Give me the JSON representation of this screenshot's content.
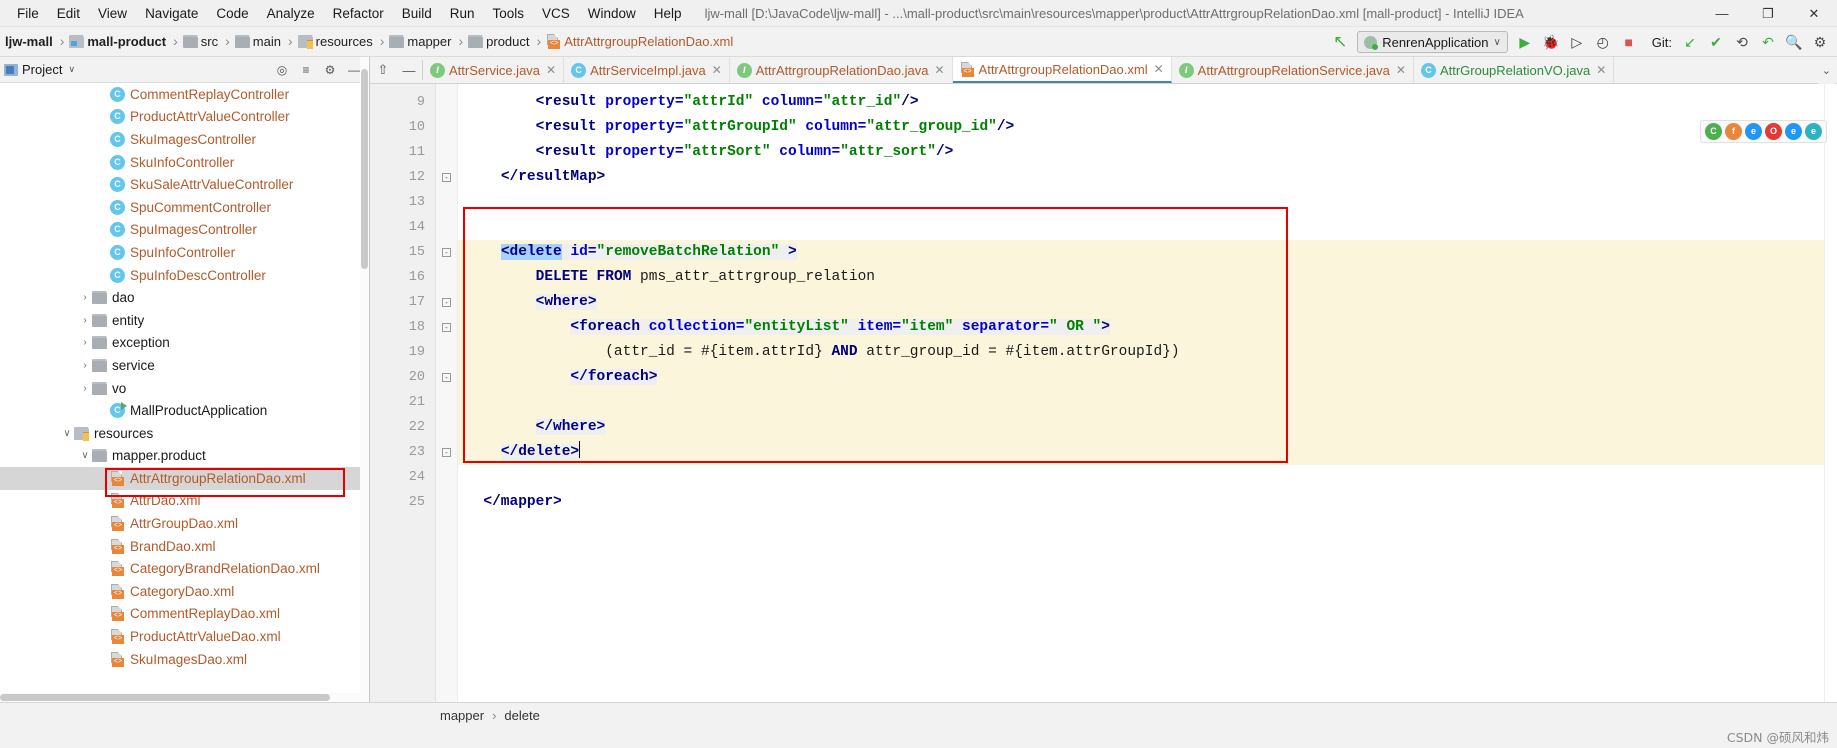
{
  "window": {
    "title": "ljw-mall [D:\\JavaCode\\ljw-mall] - ...\\mall-product\\src\\main\\resources\\mapper\\product\\AttrAttrgroupRelationDao.xml [mall-product] - IntelliJ IDEA",
    "minimize": "—",
    "maximize": "❐",
    "close": "✕"
  },
  "menu": {
    "items": [
      {
        "label": "File"
      },
      {
        "label": "Edit"
      },
      {
        "label": "View"
      },
      {
        "label": "Navigate"
      },
      {
        "label": "Code"
      },
      {
        "label": "Analyze"
      },
      {
        "label": "Refactor"
      },
      {
        "label": "Build"
      },
      {
        "label": "Run"
      },
      {
        "label": "Tools"
      },
      {
        "label": "VCS"
      },
      {
        "label": "Window"
      },
      {
        "label": "Help"
      }
    ]
  },
  "breadcrumb": {
    "items": [
      {
        "label": "ljw-mall",
        "icon": "project-icon"
      },
      {
        "label": "mall-product",
        "icon": "module-folder-icon"
      },
      {
        "label": "src",
        "icon": "folder-icon"
      },
      {
        "label": "main",
        "icon": "folder-icon"
      },
      {
        "label": "resources",
        "icon": "resources-folder-icon"
      },
      {
        "label": "mapper",
        "icon": "folder-icon"
      },
      {
        "label": "product",
        "icon": "folder-icon"
      },
      {
        "label": "AttrAttrgroupRelationDao.xml",
        "icon": "xml-file-icon"
      }
    ],
    "separator": "›"
  },
  "toolbar": {
    "back_arrow": "↖",
    "run_config": "RenrenApplication",
    "run_config_caret": "∨",
    "run_button": "▶",
    "debug_button": "🐞",
    "run_coverage_button": "▷",
    "profile_button": "◴",
    "stop_button": "■",
    "git_label": "Git:",
    "git_update": "↙",
    "git_commit": "✔",
    "git_history": "⟲",
    "git_rollback": "↶",
    "search_everywhere": "🔍",
    "settings": "⚙"
  },
  "project_panel": {
    "title": "Project",
    "caret": "∨",
    "icons": [
      "collapse-icon",
      "expand-icon",
      "settings-icon",
      "hide-icon"
    ],
    "tree": [
      {
        "indent": 5,
        "arrow": "",
        "icon": "class-icon",
        "icon_char": "C",
        "label": "CommentReplayController",
        "style": "java-orange",
        "selected": false
      },
      {
        "indent": 5,
        "arrow": "",
        "icon": "class-icon",
        "icon_char": "C",
        "label": "ProductAttrValueController",
        "style": "java-orange",
        "selected": false
      },
      {
        "indent": 5,
        "arrow": "",
        "icon": "class-icon",
        "icon_char": "C",
        "label": "SkuImagesController",
        "style": "java-orange",
        "selected": false
      },
      {
        "indent": 5,
        "arrow": "",
        "icon": "class-icon",
        "icon_char": "C",
        "label": "SkuInfoController",
        "style": "java-orange",
        "selected": false
      },
      {
        "indent": 5,
        "arrow": "",
        "icon": "class-icon",
        "icon_char": "C",
        "label": "SkuSaleAttrValueController",
        "style": "java-orange",
        "selected": false
      },
      {
        "indent": 5,
        "arrow": "",
        "icon": "class-icon",
        "icon_char": "C",
        "label": "SpuCommentController",
        "style": "java-orange",
        "selected": false
      },
      {
        "indent": 5,
        "arrow": "",
        "icon": "class-icon",
        "icon_char": "C",
        "label": "SpuImagesController",
        "style": "java-orange",
        "selected": false
      },
      {
        "indent": 5,
        "arrow": "",
        "icon": "class-icon",
        "icon_char": "C",
        "label": "SpuInfoController",
        "style": "java-orange",
        "selected": false
      },
      {
        "indent": 5,
        "arrow": "",
        "icon": "class-icon",
        "icon_char": "C",
        "label": "SpuInfoDescController",
        "style": "java-orange",
        "selected": false
      },
      {
        "indent": 4,
        "arrow": "›",
        "icon": "folder-icon",
        "icon_char": "",
        "label": "dao",
        "style": "plain",
        "selected": false
      },
      {
        "indent": 4,
        "arrow": "›",
        "icon": "folder-icon",
        "icon_char": "",
        "label": "entity",
        "style": "plain",
        "selected": false
      },
      {
        "indent": 4,
        "arrow": "›",
        "icon": "folder-icon",
        "icon_char": "",
        "label": "exception",
        "style": "plain",
        "selected": false
      },
      {
        "indent": 4,
        "arrow": "›",
        "icon": "folder-icon",
        "icon_char": "",
        "label": "service",
        "style": "plain",
        "selected": false
      },
      {
        "indent": 4,
        "arrow": "›",
        "icon": "folder-icon",
        "icon_char": "",
        "label": "vo",
        "style": "plain",
        "selected": false
      },
      {
        "indent": 5,
        "arrow": "",
        "icon": "spring-boot-class-icon",
        "icon_char": "C",
        "label": "MallProductApplication",
        "style": "plain",
        "selected": false
      },
      {
        "indent": 3,
        "arrow": "∨",
        "icon": "resources-folder-icon",
        "icon_char": "",
        "label": "resources",
        "style": "plain",
        "selected": false
      },
      {
        "indent": 4,
        "arrow": "∨",
        "icon": "folder-icon",
        "icon_char": "",
        "label": "mapper.product",
        "style": "plain",
        "selected": false
      },
      {
        "indent": 5,
        "arrow": "",
        "icon": "xml-file-icon",
        "icon_char": "",
        "label": "AttrAttrgroupRelationDao.xml",
        "style": "xml-orange",
        "selected": true
      },
      {
        "indent": 5,
        "arrow": "",
        "icon": "xml-file-icon",
        "icon_char": "",
        "label": "AttrDao.xml",
        "style": "xml-orange",
        "selected": false
      },
      {
        "indent": 5,
        "arrow": "",
        "icon": "xml-file-icon",
        "icon_char": "",
        "label": "AttrGroupDao.xml",
        "style": "xml-orange",
        "selected": false
      },
      {
        "indent": 5,
        "arrow": "",
        "icon": "xml-file-icon",
        "icon_char": "",
        "label": "BrandDao.xml",
        "style": "xml-orange",
        "selected": false
      },
      {
        "indent": 5,
        "arrow": "",
        "icon": "xml-file-icon",
        "icon_char": "",
        "label": "CategoryBrandRelationDao.xml",
        "style": "xml-orange",
        "selected": false
      },
      {
        "indent": 5,
        "arrow": "",
        "icon": "xml-file-icon",
        "icon_char": "",
        "label": "CategoryDao.xml",
        "style": "xml-orange",
        "selected": false
      },
      {
        "indent": 5,
        "arrow": "",
        "icon": "xml-file-icon",
        "icon_char": "",
        "label": "CommentReplayDao.xml",
        "style": "xml-orange",
        "selected": false
      },
      {
        "indent": 5,
        "arrow": "",
        "icon": "xml-file-icon",
        "icon_char": "",
        "label": "ProductAttrValueDao.xml",
        "style": "xml-orange",
        "selected": false
      },
      {
        "indent": 5,
        "arrow": "",
        "icon": "xml-file-icon",
        "icon_char": "",
        "label": "SkuImagesDao.xml",
        "style": "xml-orange",
        "selected": false
      }
    ]
  },
  "editor_tabs": {
    "pin_icon": "⇧",
    "minimize_icon": "—",
    "items": [
      {
        "label": "AttrService.java",
        "icon": "interface-icon",
        "icon_char": "I",
        "kind": "iface",
        "active": false,
        "close": "✕"
      },
      {
        "label": "AttrServiceImpl.java",
        "icon": "class-icon",
        "icon_char": "C",
        "kind": "class",
        "active": false,
        "close": "✕"
      },
      {
        "label": "AttrAttrgroupRelationDao.java",
        "icon": "interface-icon",
        "icon_char": "I",
        "kind": "iface",
        "active": false,
        "close": "✕"
      },
      {
        "label": "AttrAttrgroupRelationDao.xml",
        "icon": "xml-file-icon",
        "icon_char": "",
        "kind": "xml",
        "active": true,
        "close": "✕"
      },
      {
        "label": "AttrAttrgroupRelationService.java",
        "icon": "interface-icon",
        "icon_char": "I",
        "kind": "iface",
        "active": false,
        "close": "✕"
      },
      {
        "label": "AttrGroupRelationVO.java",
        "icon": "class-icon",
        "icon_char": "C",
        "kind": "class-green",
        "active": false,
        "close": "✕"
      }
    ],
    "overflow": "⌄"
  },
  "browsers": [
    {
      "name": "chrome-icon",
      "char": "C",
      "color": "#4caf50"
    },
    {
      "name": "firefox-icon",
      "char": "f",
      "color": "#e8863c"
    },
    {
      "name": "edge-chromium-icon",
      "char": "e",
      "color": "#2196f3"
    },
    {
      "name": "opera-icon",
      "char": "O",
      "color": "#e53935"
    },
    {
      "name": "internet-explorer-icon",
      "char": "e",
      "color": "#2196f3"
    },
    {
      "name": "edge-icon",
      "char": "e",
      "color": "#2bb3c0"
    }
  ],
  "code": {
    "lines": [
      {
        "num": "9",
        "fold": "",
        "highlight": false,
        "indent": 1,
        "tokens": [
          {
            "t": "        ",
            "c": "plain"
          },
          {
            "t": "<result ",
            "c": "tag"
          },
          {
            "t": "property=",
            "c": "attr"
          },
          {
            "t": "\"attrId\"",
            "c": "val"
          },
          {
            "t": " ",
            "c": "plain"
          },
          {
            "t": "column=",
            "c": "attr"
          },
          {
            "t": "\"attr_id\"",
            "c": "val"
          },
          {
            "t": "/>",
            "c": "tag"
          }
        ]
      },
      {
        "num": "10",
        "fold": "",
        "highlight": false,
        "indent": 1,
        "tokens": [
          {
            "t": "        ",
            "c": "plain"
          },
          {
            "t": "<result ",
            "c": "tag"
          },
          {
            "t": "property=",
            "c": "attr"
          },
          {
            "t": "\"attrGroupId\"",
            "c": "val"
          },
          {
            "t": " ",
            "c": "plain"
          },
          {
            "t": "column=",
            "c": "attr"
          },
          {
            "t": "\"attr_group_id\"",
            "c": "val"
          },
          {
            "t": "/>",
            "c": "tag"
          }
        ]
      },
      {
        "num": "11",
        "fold": "",
        "highlight": false,
        "indent": 1,
        "tokens": [
          {
            "t": "        ",
            "c": "plain"
          },
          {
            "t": "<result ",
            "c": "tag"
          },
          {
            "t": "property=",
            "c": "attr"
          },
          {
            "t": "\"attrSort\"",
            "c": "val"
          },
          {
            "t": " ",
            "c": "plain"
          },
          {
            "t": "column=",
            "c": "attr"
          },
          {
            "t": "\"attr_sort\"",
            "c": "val"
          },
          {
            "t": "/>",
            "c": "tag"
          }
        ]
      },
      {
        "num": "12",
        "fold": "-",
        "highlight": false,
        "indent": 0,
        "tokens": [
          {
            "t": "    ",
            "c": "plain"
          },
          {
            "t": "</resultMap>",
            "c": "tag"
          }
        ]
      },
      {
        "num": "13",
        "fold": "",
        "highlight": false,
        "indent": 0,
        "tokens": []
      },
      {
        "num": "14",
        "fold": "",
        "highlight": false,
        "indent": 0,
        "tokens": []
      },
      {
        "num": "15",
        "fold": "-",
        "highlight": true,
        "indent": 0,
        "tokens": [
          {
            "t": "    ",
            "c": "plain"
          },
          {
            "t": "<delete",
            "c": "tag-sel"
          },
          {
            "t": " ",
            "c": "plain-bg"
          },
          {
            "t": "id=",
            "c": "attr-bg"
          },
          {
            "t": "\"removeBatchRelation\"",
            "c": "val-bg"
          },
          {
            "t": " >",
            "c": "tag-bg"
          }
        ]
      },
      {
        "num": "16",
        "fold": "",
        "highlight": true,
        "indent": 1,
        "tokens": [
          {
            "t": "        ",
            "c": "plain"
          },
          {
            "t": "DELETE FROM",
            "c": "sql"
          },
          {
            "t": " pms_attr_attrgroup_relation",
            "c": "plain"
          }
        ]
      },
      {
        "num": "17",
        "fold": "-",
        "highlight": true,
        "indent": 1,
        "tokens": [
          {
            "t": "        ",
            "c": "plain"
          },
          {
            "t": "<where>",
            "c": "tag-bg"
          }
        ]
      },
      {
        "num": "18",
        "fold": "-",
        "highlight": true,
        "indent": 2,
        "tokens": [
          {
            "t": "            ",
            "c": "plain"
          },
          {
            "t": "<foreach ",
            "c": "tag-bg"
          },
          {
            "t": "collection=",
            "c": "attr-bg"
          },
          {
            "t": "\"entityList\"",
            "c": "val-bg"
          },
          {
            "t": " ",
            "c": "plain-bg"
          },
          {
            "t": "item=",
            "c": "attr-bg"
          },
          {
            "t": "\"item\"",
            "c": "val-bg"
          },
          {
            "t": " ",
            "c": "plain-bg"
          },
          {
            "t": "separator=",
            "c": "attr-bg"
          },
          {
            "t": "\" OR \"",
            "c": "val-bg"
          },
          {
            "t": ">",
            "c": "tag-bg"
          }
        ]
      },
      {
        "num": "19",
        "fold": "",
        "highlight": true,
        "indent": 3,
        "tokens": [
          {
            "t": "                ",
            "c": "plain"
          },
          {
            "t": "(attr_id = #{item.attrId} ",
            "c": "plain"
          },
          {
            "t": "AND",
            "c": "sql"
          },
          {
            "t": " attr_group_id = #{item.attrGroupId})",
            "c": "plain"
          }
        ]
      },
      {
        "num": "20",
        "fold": "-",
        "highlight": true,
        "indent": 2,
        "tokens": [
          {
            "t": "            ",
            "c": "plain"
          },
          {
            "t": "</foreach>",
            "c": "tag-bg"
          }
        ]
      },
      {
        "num": "21",
        "fold": "",
        "highlight": true,
        "indent": 2,
        "tokens": []
      },
      {
        "num": "22",
        "fold": "",
        "highlight": true,
        "indent": 1,
        "tokens": [
          {
            "t": "        ",
            "c": "plain"
          },
          {
            "t": "</where>",
            "c": "tag-bg"
          }
        ]
      },
      {
        "num": "23",
        "fold": "-",
        "highlight": true,
        "indent": 0,
        "tokens": [
          {
            "t": "    ",
            "c": "plain"
          },
          {
            "t": "</delete>",
            "c": "tag-bg"
          },
          {
            "t": "|",
            "c": "caret"
          }
        ]
      },
      {
        "num": "24",
        "fold": "",
        "highlight": false,
        "indent": 0,
        "tokens": []
      },
      {
        "num": "25",
        "fold": "",
        "highlight": false,
        "indent": 0,
        "tokens": [
          {
            "t": "  ",
            "c": "plain"
          },
          {
            "t": "</mapper>",
            "c": "tag"
          }
        ]
      }
    ]
  },
  "bottom_breadcrumb": {
    "items": [
      "mapper",
      "delete"
    ],
    "separator": "›"
  },
  "watermark": "CSDN @硕风和炜",
  "colors": {
    "accent": "#4383c4",
    "annotation_red": "#e50000",
    "highlight_yellow": "#fbf5dc",
    "selection_blue": "#a6d2ff",
    "xml_orange": "#b35a2a"
  }
}
